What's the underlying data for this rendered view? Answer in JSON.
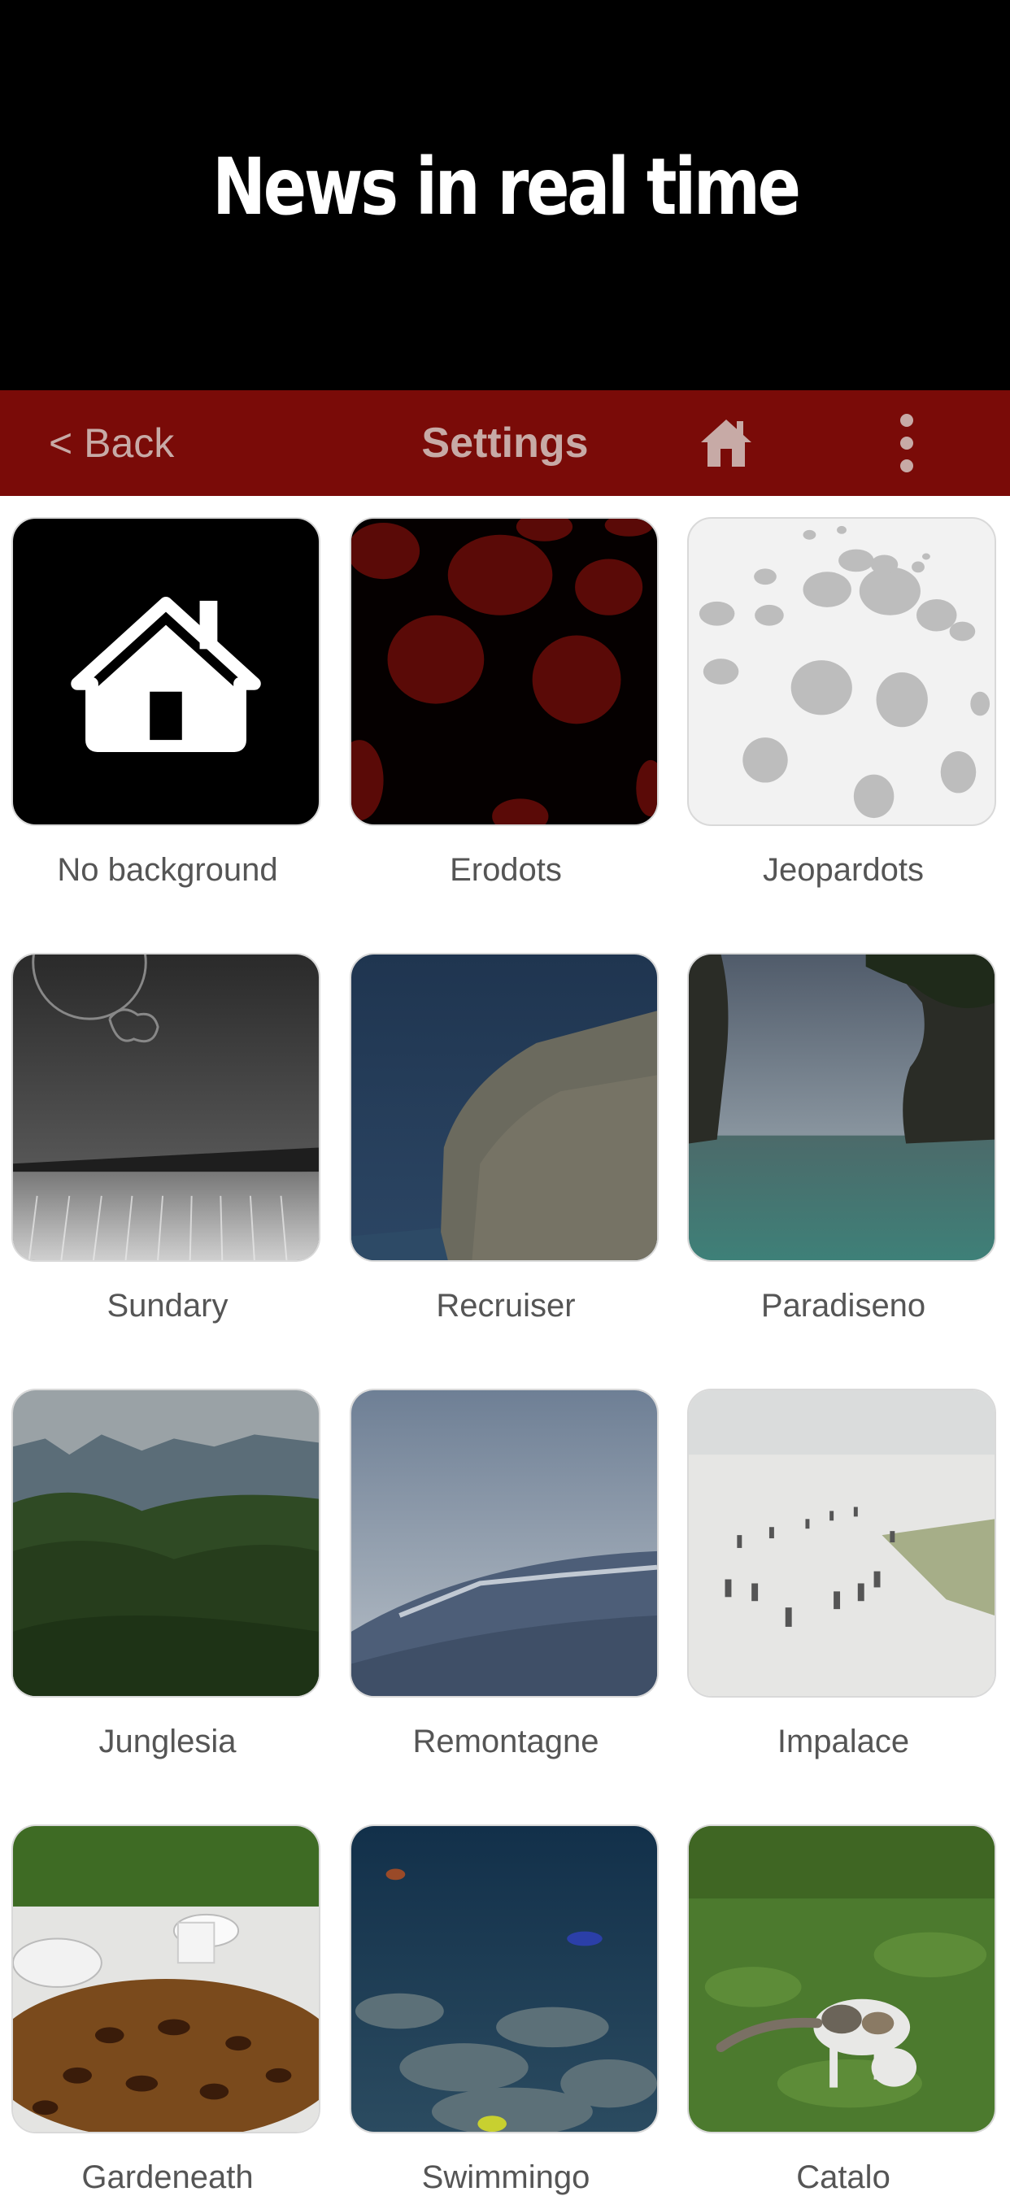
{
  "header": {
    "title": "News in real time"
  },
  "navbar": {
    "back_label": "< Back",
    "title": "Settings",
    "home_icon": "home-icon",
    "more_icon": "more-vertical-icon"
  },
  "colors": {
    "header_bg": "#000000",
    "navbar_bg": "#7a0b08",
    "nav_text": "#c7aaa6"
  },
  "backgrounds": [
    {
      "label": "No background"
    },
    {
      "label": "Erodots"
    },
    {
      "label": "Jeopardots"
    },
    {
      "label": "Sundary"
    },
    {
      "label": "Recruiser"
    },
    {
      "label": "Paradiseno"
    },
    {
      "label": "Junglesia"
    },
    {
      "label": "Remontagne"
    },
    {
      "label": "Impalace"
    },
    {
      "label": "Gardeneath"
    },
    {
      "label": "Swimmingo"
    },
    {
      "label": "Catalo"
    }
  ]
}
